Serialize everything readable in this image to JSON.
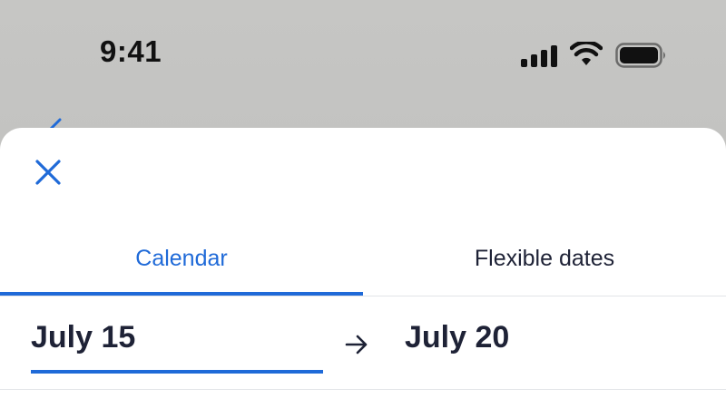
{
  "status_bar": {
    "time": "9:41",
    "icons": [
      "cellular-signal-icon",
      "wifi-icon",
      "battery-icon"
    ]
  },
  "sheet": {
    "close_icon": "close-icon",
    "tabs": [
      {
        "label": "Calendar",
        "active": true
      },
      {
        "label": "Flexible dates",
        "active": false
      }
    ],
    "dates": {
      "start": "July 15",
      "end": "July 20",
      "arrow_icon": "arrow-right-icon"
    }
  },
  "colors": {
    "accent": "#1f6ad8",
    "text_dark": "#1e2236",
    "divider": "#e2e4e8",
    "backdrop": "#c6c6c4"
  }
}
